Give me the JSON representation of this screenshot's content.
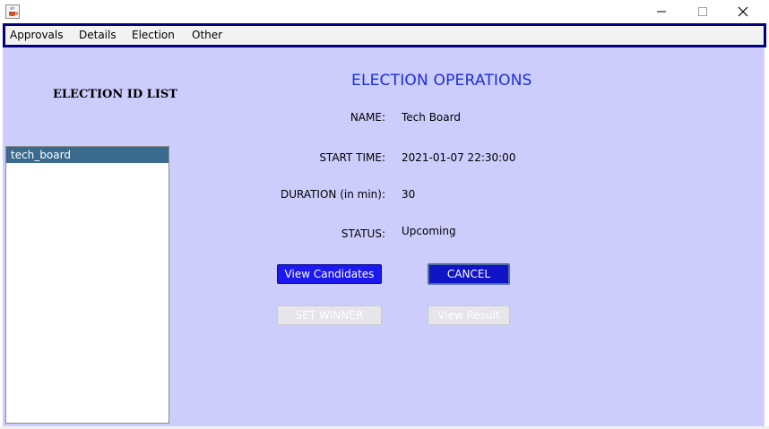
{
  "menu": {
    "items": [
      "Approvals",
      "Details",
      "Election",
      "Other"
    ]
  },
  "left_panel": {
    "title": "ELECTION ID LIST",
    "items": [
      "tech_board"
    ]
  },
  "main": {
    "heading": "ELECTION OPERATIONS",
    "fields": {
      "name": {
        "label": "NAME:",
        "value": "Tech Board"
      },
      "start_time": {
        "label": "START TIME:",
        "value": "2021-01-07 22:30:00"
      },
      "duration": {
        "label": "DURATION (in min):",
        "value": "30"
      },
      "status": {
        "label": "STATUS:",
        "value": "Upcoming"
      }
    },
    "buttons": {
      "view_candidates": "View Candidates",
      "cancel": "CANCEL",
      "set_winner": "SET WINNER",
      "view_result": "View Result"
    }
  },
  "colors": {
    "content_bg": "#cccdfd",
    "heading": "#1c2fd8",
    "menubar_border": "#000080",
    "selected_item": "#3b6a8f",
    "primary_button": "#1b18f0"
  },
  "icons": {
    "app": "java-coffee-icon",
    "minimize": "minimize-icon",
    "maximize": "maximize-icon",
    "close": "close-icon"
  }
}
